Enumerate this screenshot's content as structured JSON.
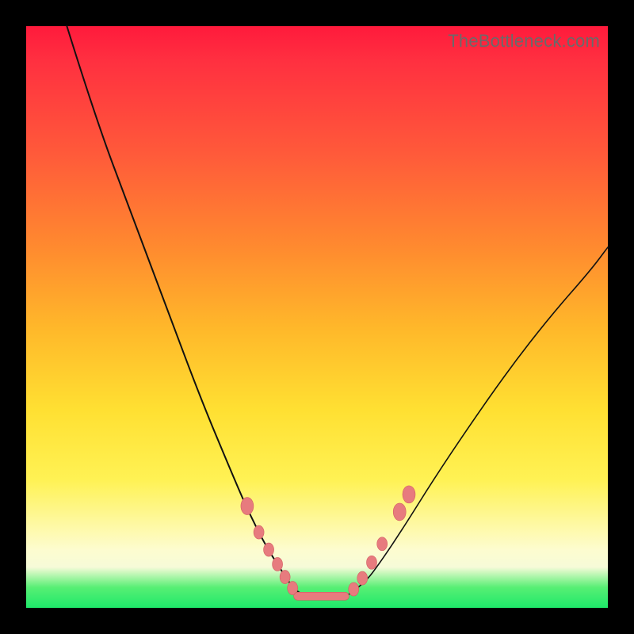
{
  "watermark": "TheBottleneck.com",
  "colors": {
    "bead": "#e77b7e",
    "bead_stroke": "#d35e62",
    "curve": "#111111",
    "bg_black": "#000000"
  },
  "chart_data": {
    "type": "line",
    "title": "",
    "xlabel": "",
    "ylabel": "",
    "xlim": [
      0,
      100
    ],
    "ylim": [
      0,
      100
    ],
    "grid": false,
    "legend": false,
    "series": [
      {
        "name": "left-branch",
        "x": [
          7,
          12,
          18,
          24,
          30,
          35,
          38,
          41,
          43.5,
          46,
          48
        ],
        "y": [
          100,
          84,
          68,
          52,
          36,
          24,
          17,
          11,
          7,
          3.2,
          2
        ]
      },
      {
        "name": "right-branch",
        "x": [
          55,
          58,
          61,
          65,
          70,
          76,
          83,
          90,
          97,
          100
        ],
        "y": [
          2,
          4,
          8,
          14,
          22,
          31,
          41,
          50,
          58,
          62
        ]
      },
      {
        "name": "floor",
        "x": [
          46,
          55.5
        ],
        "y": [
          2,
          2
        ]
      }
    ],
    "markers_left": [
      [
        38,
        17.5
      ],
      [
        40,
        13
      ],
      [
        41.7,
        10
      ],
      [
        43.2,
        7.5
      ],
      [
        44.5,
        5.3
      ],
      [
        45.8,
        3.4
      ]
    ],
    "markers_right": [
      [
        56.3,
        3.2
      ],
      [
        57.8,
        5.1
      ],
      [
        59.4,
        7.8
      ],
      [
        61.2,
        11
      ],
      [
        64.2,
        16.5
      ],
      [
        65.8,
        19.5
      ]
    ],
    "floor_segment": {
      "x0": 46,
      "x1": 55.5,
      "y": 2
    }
  }
}
